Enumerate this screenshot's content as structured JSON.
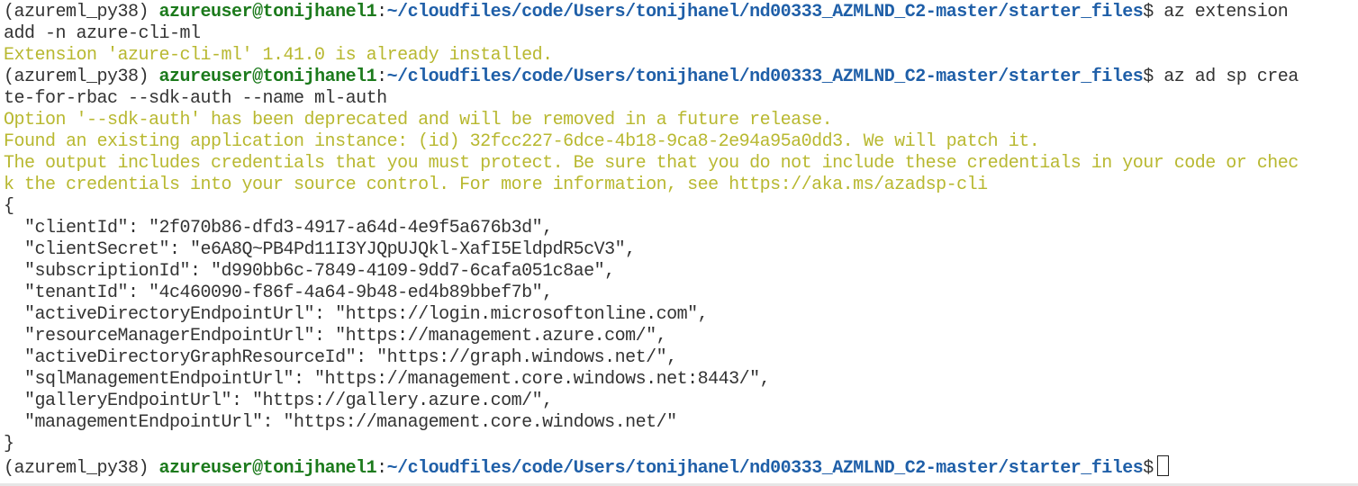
{
  "terminal": {
    "prompt": {
      "env": "(azureml_py38)",
      "user_host": "azureuser@tonijhanel1",
      "separator": ":",
      "path": "~/cloudfiles/code/Users/tonijhanel/nd00333_AZMLND_C2-master/starter_files",
      "dollar": "$"
    },
    "commands": {
      "cmd1_line1": " az extension",
      "cmd1_line2": "add -n azure-cli-ml",
      "cmd2_line1": " az ad sp crea",
      "cmd2_line2": "te-for-rbac --sdk-auth --name ml-auth"
    },
    "messages": {
      "already_installed": "Extension 'azure-cli-ml' 1.41.0 is already installed.",
      "deprecated": "Option '--sdk-auth' has been deprecated and will be removed in a future release.",
      "found_app": "Found an existing application instance: (id) 32fcc227-6dce-4b18-9ca8-2e94a95a0dd3. We will patch it.",
      "credentials_warning_1": "The output includes credentials that you must protect. Be sure that you do not include these credentials in your code or chec",
      "credentials_warning_2": "k the credentials into your source control. For more information, see https://aka.ms/azadsp-cli"
    },
    "json_output": {
      "open": "{",
      "lines": [
        "  \"clientId\": \"2f070b86-dfd3-4917-a64d-4e9f5a676b3d\",",
        "  \"clientSecret\": \"e6A8Q~PB4Pd11I3YJQpUJQkl-XafI5EldpdR5cV3\",",
        "  \"subscriptionId\": \"d990bb6c-7849-4109-9dd7-6cafa051c8ae\",",
        "  \"tenantId\": \"4c460090-f86f-4a64-9b48-ed4b89bbef7b\",",
        "  \"activeDirectoryEndpointUrl\": \"https://login.microsoftonline.com\",",
        "  \"resourceManagerEndpointUrl\": \"https://management.azure.com/\",",
        "  \"activeDirectoryGraphResourceId\": \"https://graph.windows.net/\",",
        "  \"sqlManagementEndpointUrl\": \"https://management.core.windows.net:8443/\",",
        "  \"galleryEndpointUrl\": \"https://gallery.azure.com/\",",
        "  \"managementEndpointUrl\": \"https://management.core.windows.net/\""
      ],
      "close": "}"
    },
    "colors": {
      "background": "#ffffff",
      "text": "#333333",
      "user_host": "#1c7a1c",
      "path": "#1f5fa8",
      "warning": "#b8b830"
    }
  }
}
